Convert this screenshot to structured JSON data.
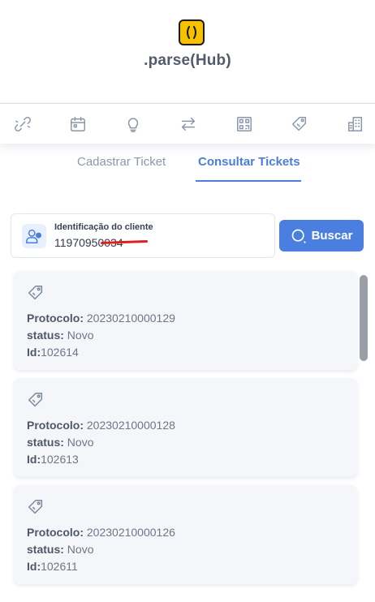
{
  "app": {
    "name": ".parse(Hub)"
  },
  "nav": {
    "icons": [
      "link-icon",
      "calendar-icon",
      "lightbulb-icon",
      "transfer-icon",
      "qr-code-icon",
      "tag-icon",
      "building-icon"
    ]
  },
  "tabs": {
    "register": "Cadastrar Ticket",
    "consult": "Consultar Tickets",
    "active": "Consultar Tickets"
  },
  "search": {
    "label": "Identificação do cliente",
    "value": "11970950034",
    "button": "Buscar"
  },
  "tickets": [
    {
      "protocol_label": "Protocolo:",
      "protocol": "20230210000129",
      "status_label": "status:",
      "status": "Novo",
      "id_label": "Id:",
      "id": "102614"
    },
    {
      "protocol_label": "Protocolo:",
      "protocol": "20230210000128",
      "status_label": "status:",
      "status": "Novo",
      "id_label": "Id:",
      "id": "102613"
    },
    {
      "protocol_label": "Protocolo:",
      "protocol": "20230210000126",
      "status_label": "status:",
      "status": "Novo",
      "id_label": "Id:",
      "id": "102611"
    }
  ],
  "colors": {
    "accent": "#4a7fd8",
    "button": "#4a7fe0",
    "logo": "#f6c200",
    "redaction": "#e02020"
  }
}
